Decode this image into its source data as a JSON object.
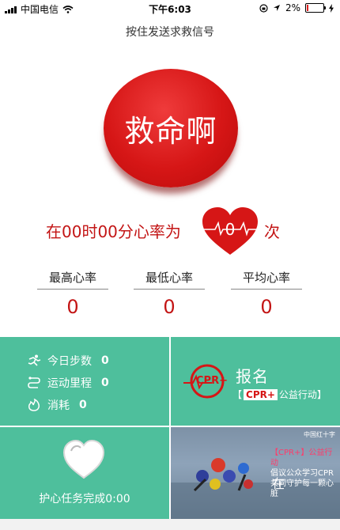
{
  "status_bar": {
    "carrier": "中国电信",
    "time": "下午6:03",
    "battery": "2%"
  },
  "header": {
    "subtitle": "按住发送求救信号"
  },
  "sos_button": {
    "label": "救命啊"
  },
  "heart_rate": {
    "prefix": "在00时00分心率为",
    "value": "0",
    "suffix": "次"
  },
  "stats": [
    {
      "label": "最高心率",
      "value": "0"
    },
    {
      "label": "最低心率",
      "value": "0"
    },
    {
      "label": "平均心率",
      "value": "0"
    }
  ],
  "activity": {
    "steps": {
      "label": "今日步数",
      "value": "0"
    },
    "distance": {
      "label": "运动里程",
      "value": "0"
    },
    "calories": {
      "label": "消耗",
      "value": "0"
    }
  },
  "signup": {
    "title": "报名",
    "logo_text": "CPR+",
    "bracket_open": "【",
    "tag": "CPR+",
    "campaign": "公益行动",
    "bracket_close": "】"
  },
  "guard": {
    "label": "护心任务完成0:00"
  },
  "video": {
    "title_lines": [
      "【CPR+】公益行动",
      "倡议公众学习CPR",
      "共同守护每一颗心脏"
    ],
    "overlay_char": "在",
    "logo": "中国红十字"
  },
  "colors": {
    "accent_red": "#d61616",
    "tile_green": "#4ebf9c"
  }
}
